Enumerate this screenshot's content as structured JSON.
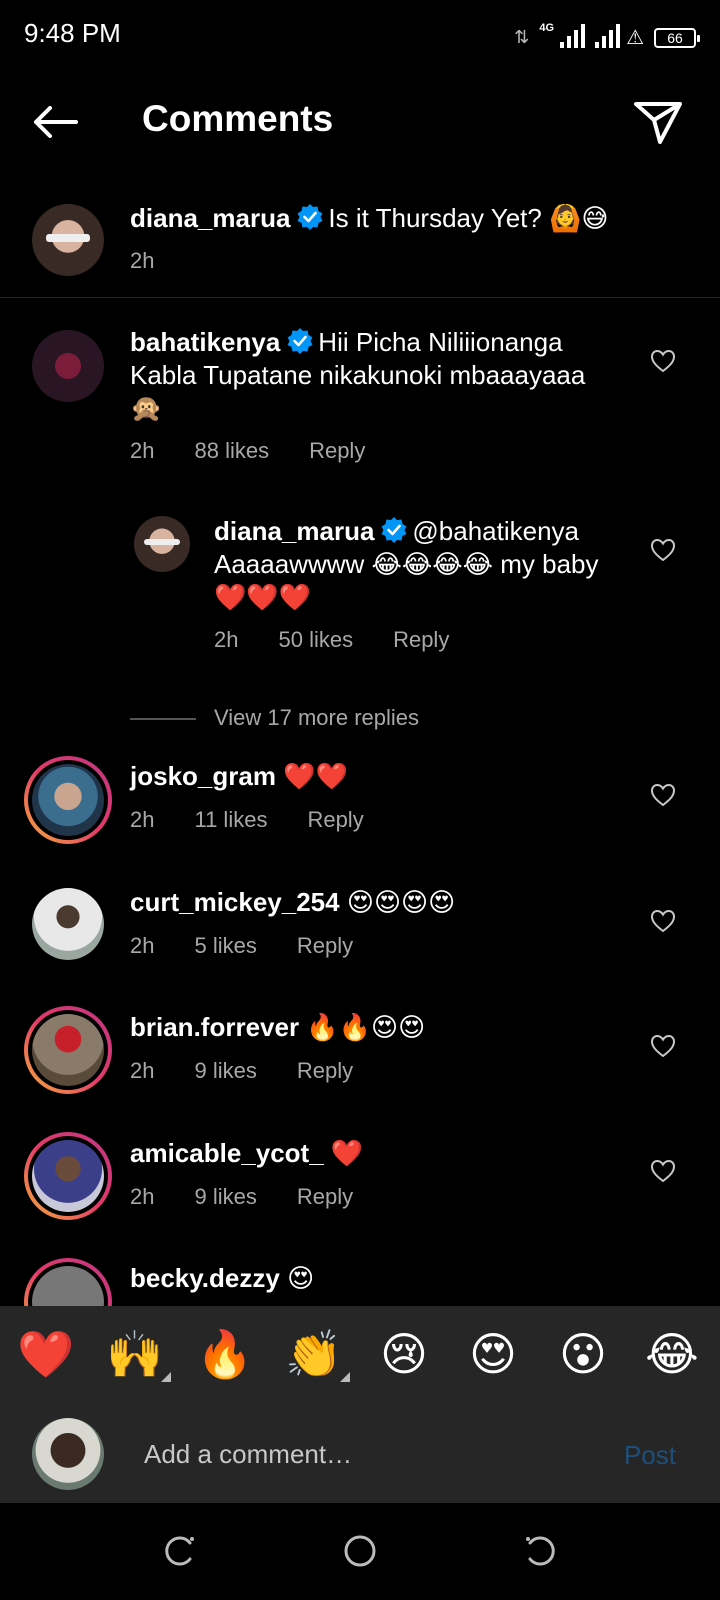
{
  "status": {
    "time": "9:48 PM",
    "network": "4G",
    "battery": "66"
  },
  "header": {
    "title": "Comments"
  },
  "caption": {
    "username": "diana_marua",
    "text": "Is it Thursday Yet? 🙆😅",
    "time": "2h"
  },
  "comments": [
    {
      "username": "bahatikenya",
      "text": "Hii Picha Niliiionanga Kabla Tupatane nikakunoki mbaaayaaa 🙊",
      "time": "2h",
      "likes": "88 likes",
      "reply": "Reply"
    },
    {
      "username": "diana_marua",
      "text": "@bahatikenya Aaaaawwww 😂😂😂😂 my baby ❤️❤️❤️",
      "time": "2h",
      "likes": "50 likes",
      "reply": "Reply"
    },
    {
      "username": "josko_gram",
      "text": "❤️❤️",
      "time": "2h",
      "likes": "11 likes",
      "reply": "Reply"
    },
    {
      "username": "curt_mickey_254",
      "text": "😍😍😍😍",
      "time": "2h",
      "likes": "5 likes",
      "reply": "Reply"
    },
    {
      "username": "brian.forrever",
      "text": "🔥🔥😍😍",
      "time": "2h",
      "likes": "9 likes",
      "reply": "Reply"
    },
    {
      "username": "amicable_ycot_",
      "text": "❤️",
      "time": "2h",
      "likes": "9 likes",
      "reply": "Reply"
    },
    {
      "username": "becky.dezzy",
      "text": "😍"
    }
  ],
  "view_more_replies": "View 17 more replies",
  "quick_emojis": [
    "❤️",
    "🙌",
    "🔥",
    "👏",
    "😢",
    "😍",
    "😮",
    "😂"
  ],
  "composer": {
    "placeholder": "Add a comment…",
    "post_label": "Post"
  },
  "colors": {
    "verified": "#0095f6",
    "post_disabled": "#1e4f7a",
    "panel": "#262626"
  }
}
